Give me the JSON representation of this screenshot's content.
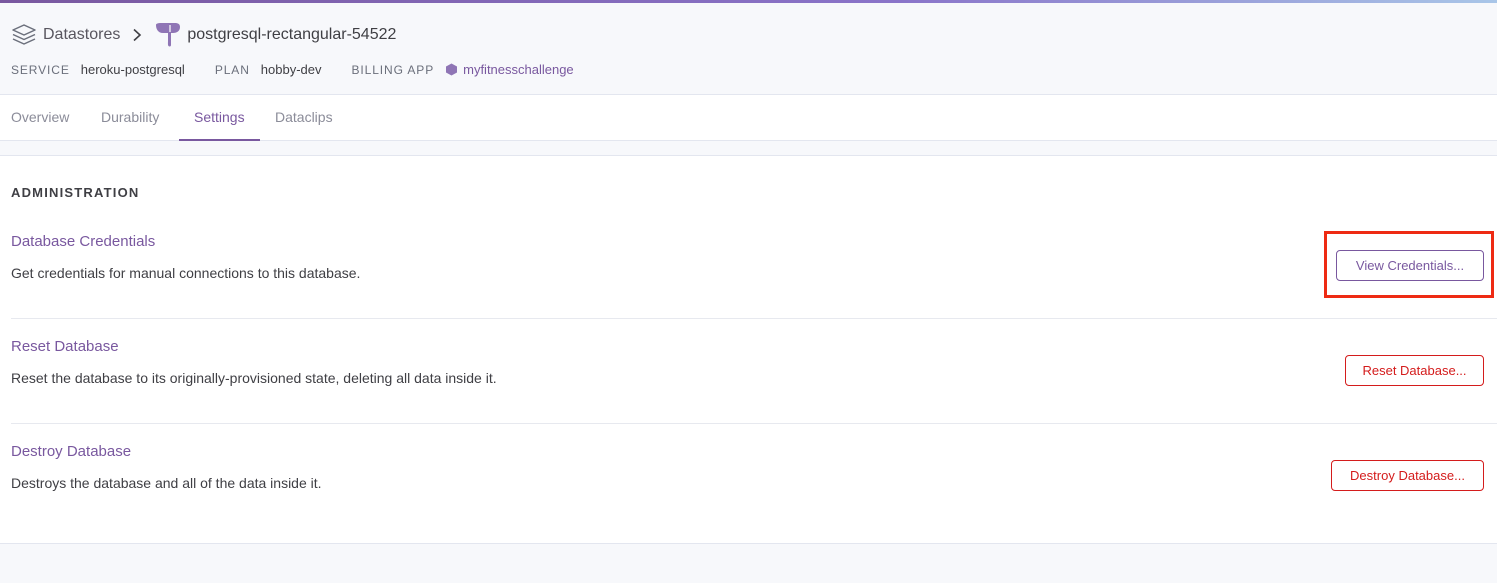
{
  "breadcrumb": {
    "parent_label": "Datastores",
    "current_label": "postgresql-rectangular-54522"
  },
  "meta": {
    "service_key": "SERVICE",
    "service_value": "heroku-postgresql",
    "plan_key": "PLAN",
    "plan_value": "hobby-dev",
    "billing_key": "BILLING APP",
    "billing_value": "myfitnesschallenge"
  },
  "tabs": [
    {
      "label": "Overview",
      "active": false
    },
    {
      "label": "Durability",
      "active": false
    },
    {
      "label": "Settings",
      "active": true
    },
    {
      "label": "Dataclips",
      "active": false
    }
  ],
  "administration": {
    "title": "ADMINISTRATION",
    "rows": [
      {
        "title": "Database Credentials",
        "description": "Get credentials for manual connections to this database.",
        "button": "View Credentials..."
      },
      {
        "title": "Reset Database",
        "description": "Reset the database to its originally-provisioned state, deleting all data inside it.",
        "button": "Reset Database..."
      },
      {
        "title": "Destroy Database",
        "description": "Destroys the database and all of the data inside it.",
        "button": "Destroy Database..."
      }
    ]
  },
  "icons": {
    "datastores": "stack-layers-icon",
    "separator": "chevron-right-icon",
    "postgres": "postgres-elephant-icon",
    "app": "hexagon-icon"
  },
  "colors": {
    "accent": "#79589f",
    "danger": "#d41c1c",
    "highlight": "#ee2a13"
  }
}
